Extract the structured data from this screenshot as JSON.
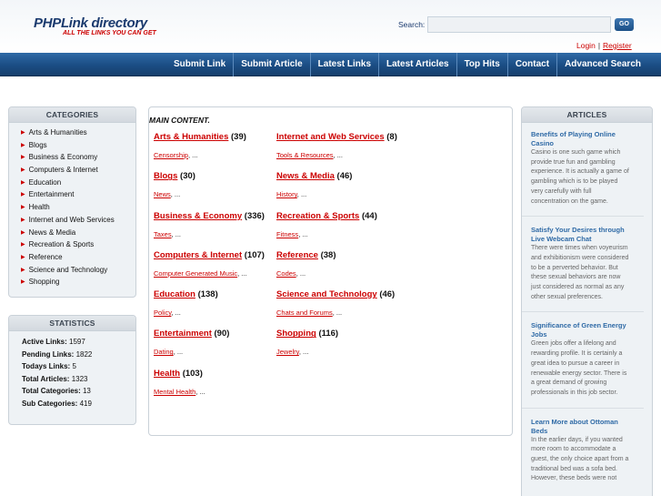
{
  "header": {
    "logo_title": "PHPLink directory",
    "logo_tagline": "ALL THE LINKS YOU CAN GET",
    "search_label": "Search:",
    "search_value": "",
    "go_label": "GO",
    "login_label": "Login",
    "separator": "|",
    "register_label": "Register"
  },
  "nav": [
    "Submit Link",
    "Submit Article",
    "Latest Links",
    "Latest Articles",
    "Top Hits",
    "Contact",
    "Advanced Search"
  ],
  "categories_panel": {
    "title": "CATEGORIES",
    "items": [
      "Arts & Humanities",
      "Blogs",
      "Business & Economy",
      "Computers & Internet",
      "Education",
      "Entertainment",
      "Health",
      "Internet and Web Services",
      "News & Media",
      "Recreation & Sports",
      "Reference",
      "Science and Technology",
      "Shopping"
    ]
  },
  "statistics_panel": {
    "title": "STATISTICS",
    "rows": [
      {
        "label": "Active Links:",
        "value": "1597"
      },
      {
        "label": "Pending Links:",
        "value": "1822"
      },
      {
        "label": "Todays Links:",
        "value": "5"
      },
      {
        "label": "Total Articles:",
        "value": "1323"
      },
      {
        "label": "Total Categories:",
        "value": "13"
      },
      {
        "label": "Sub Categories:",
        "value": "419"
      }
    ]
  },
  "main": {
    "title": "MAIN CONTENT",
    "title_suffix": ".",
    "left_column": [
      {
        "name": "Arts & Humanities",
        "count": "(39)",
        "sub": "Censorship",
        "more": ", ..."
      },
      {
        "name": "Blogs",
        "count": "(30)",
        "sub": "News",
        "more": ", ..."
      },
      {
        "name": "Business & Economy",
        "count": "(336)",
        "sub": "Taxes",
        "more": ", ..."
      },
      {
        "name": "Computers & Internet",
        "count": "(107)",
        "sub": "Computer Generated Music",
        "more": ", ..."
      },
      {
        "name": "Education",
        "count": "(138)",
        "sub": "Policy",
        "more": ", ..."
      },
      {
        "name": "Entertainment",
        "count": "(90)",
        "sub": "Dating",
        "more": ", ..."
      },
      {
        "name": "Health",
        "count": "(103)",
        "sub": "Mental Health",
        "more": ", ..."
      }
    ],
    "right_column": [
      {
        "name": "Internet and Web Services",
        "count": "(8)",
        "sub": "Tools & Resources",
        "more": ", ..."
      },
      {
        "name": "News & Media",
        "count": "(46)",
        "sub": "History",
        "more": ", ..."
      },
      {
        "name": "Recreation & Sports",
        "count": "(44)",
        "sub": "Fitness",
        "more": ", ..."
      },
      {
        "name": "Reference",
        "count": "(38)",
        "sub": "Codes",
        "more": ", ..."
      },
      {
        "name": "Science and Technology",
        "count": "(46)",
        "sub": "Chats and Forums",
        "more": ", ..."
      },
      {
        "name": "Shopping",
        "count": "(116)",
        "sub": "Jewelry",
        "more": ", ..."
      }
    ]
  },
  "articles_panel": {
    "title": "ARTICLES",
    "items": [
      {
        "title_lines": [
          "Benefits of Playing Online",
          "Casino"
        ],
        "text_lines": [
          "Casino is one such game which",
          "provide true fun and gambling",
          "experience. It is actually a game of",
          "gambling which is to be played",
          "very carefully with full",
          "concentration on the game."
        ]
      },
      {
        "title_lines": [
          "Satisfy Your Desires through",
          "Live Webcam Chat"
        ],
        "text_lines": [
          "There were times when voyeurism",
          "and exhibitionism were considered",
          "to be a perverted behavior. But",
          "these sexual behaviors are now",
          "just considered as normal as any",
          "other sexual preferences."
        ]
      },
      {
        "title_lines": [
          "Significance of Green Energy",
          "Jobs"
        ],
        "text_lines": [
          "Green jobs offer a lifelong and",
          "rewarding profile. It is certainly a",
          "great idea to pursue a career in",
          "renewable energy sector. There is",
          "a great demand of growing",
          "professionals in this job sector."
        ]
      },
      {
        "title_lines": [
          "Learn More about Ottoman Beds"
        ],
        "text_lines": [
          "In the earlier days, if you wanted",
          "more room to accommodate a",
          "guest, the only choice apart from a",
          "traditional bed was a sofa bed.",
          "However, these beds were not"
        ]
      }
    ]
  },
  "colors": {
    "accent_red": "#cc0000",
    "nav_blue": "#1b4d84",
    "article_title_blue": "#2f6aa6",
    "logo_navy": "#1a3a6e"
  }
}
